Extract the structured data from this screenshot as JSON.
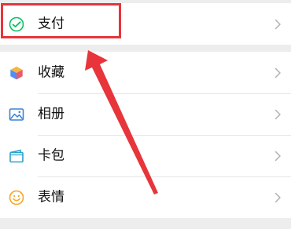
{
  "colors": {
    "background": "#ededed",
    "card": "#ffffff",
    "pay_green": "#07c160",
    "annotation_red": "#e8343b",
    "chevron": "#b2b2b2"
  },
  "payment": {
    "label": "支付",
    "icon": "wechat-pay-icon"
  },
  "menu": {
    "items": [
      {
        "label": "收藏",
        "icon": "favorites-cube-icon"
      },
      {
        "label": "相册",
        "icon": "photo-album-icon"
      },
      {
        "label": "卡包",
        "icon": "card-wallet-icon"
      },
      {
        "label": "表情",
        "icon": "smiley-icon"
      }
    ]
  },
  "annotation": {
    "type": "highlight-box-with-arrow",
    "target": "支付"
  }
}
